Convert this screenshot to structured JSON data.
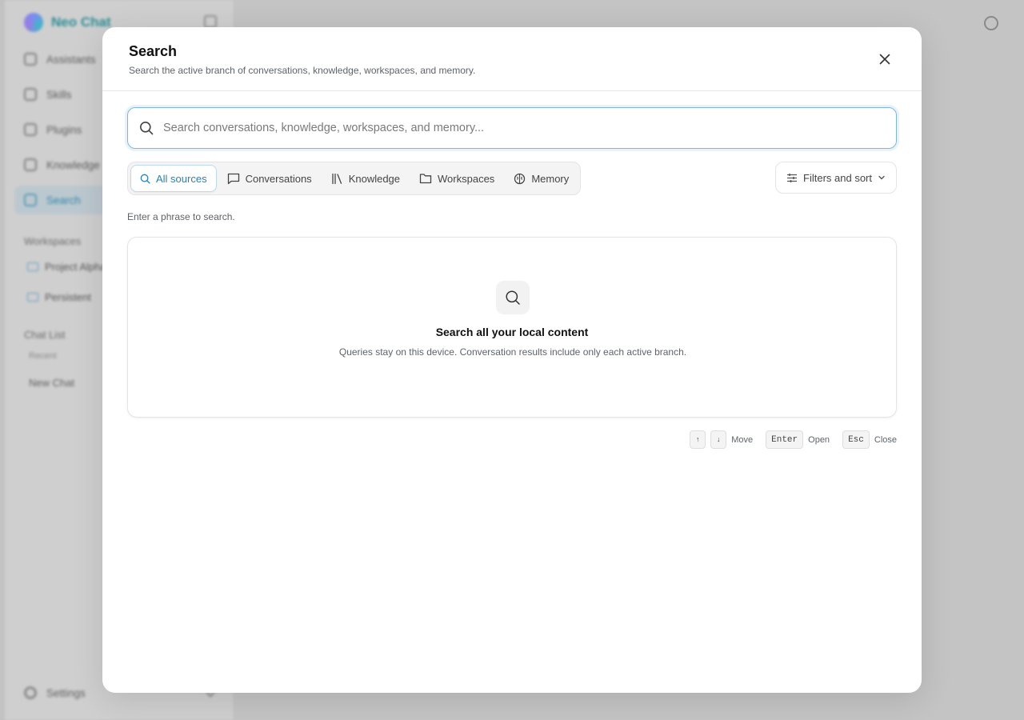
{
  "app": {
    "brand": "Neo Chat",
    "nav": [
      {
        "label": "Assistants"
      },
      {
        "label": "Skills"
      },
      {
        "label": "Plugins"
      },
      {
        "label": "Knowledge"
      },
      {
        "label": "Search"
      }
    ],
    "workspaces_label": "Workspaces",
    "workspaces": [
      "Project Alpha",
      "Persistent"
    ],
    "chat_list_label": "Chat List",
    "recent_label": "Recent",
    "chats": [
      "New Chat"
    ],
    "settings_label": "Settings"
  },
  "modal": {
    "title": "Search",
    "subtitle": "Search the active branch of conversations, knowledge, workspaces, and memory.",
    "search": {
      "placeholder": "Search conversations, knowledge, workspaces, and memory...",
      "value": ""
    },
    "tabs": [
      {
        "label": "All sources",
        "icon": "search-icon",
        "active": true
      },
      {
        "label": "Conversations",
        "icon": "message-icon",
        "active": false
      },
      {
        "label": "Knowledge",
        "icon": "library-icon",
        "active": false
      },
      {
        "label": "Workspaces",
        "icon": "folder-icon",
        "active": false
      },
      {
        "label": "Memory",
        "icon": "brain-icon",
        "active": false
      }
    ],
    "filters_label": "Filters and sort",
    "hint": "Enter a phrase to search.",
    "empty": {
      "title": "Search all your local content",
      "description": "Queries stay on this device. Conversation results include only each active branch."
    },
    "shortcuts": {
      "up": "↑",
      "down": "↓",
      "move": "Move",
      "enter_key": "Enter",
      "open": "Open",
      "esc_key": "Esc",
      "close": "Close"
    }
  },
  "colors": {
    "accent": "#2d7fb0",
    "brand": "#2b8d96"
  }
}
